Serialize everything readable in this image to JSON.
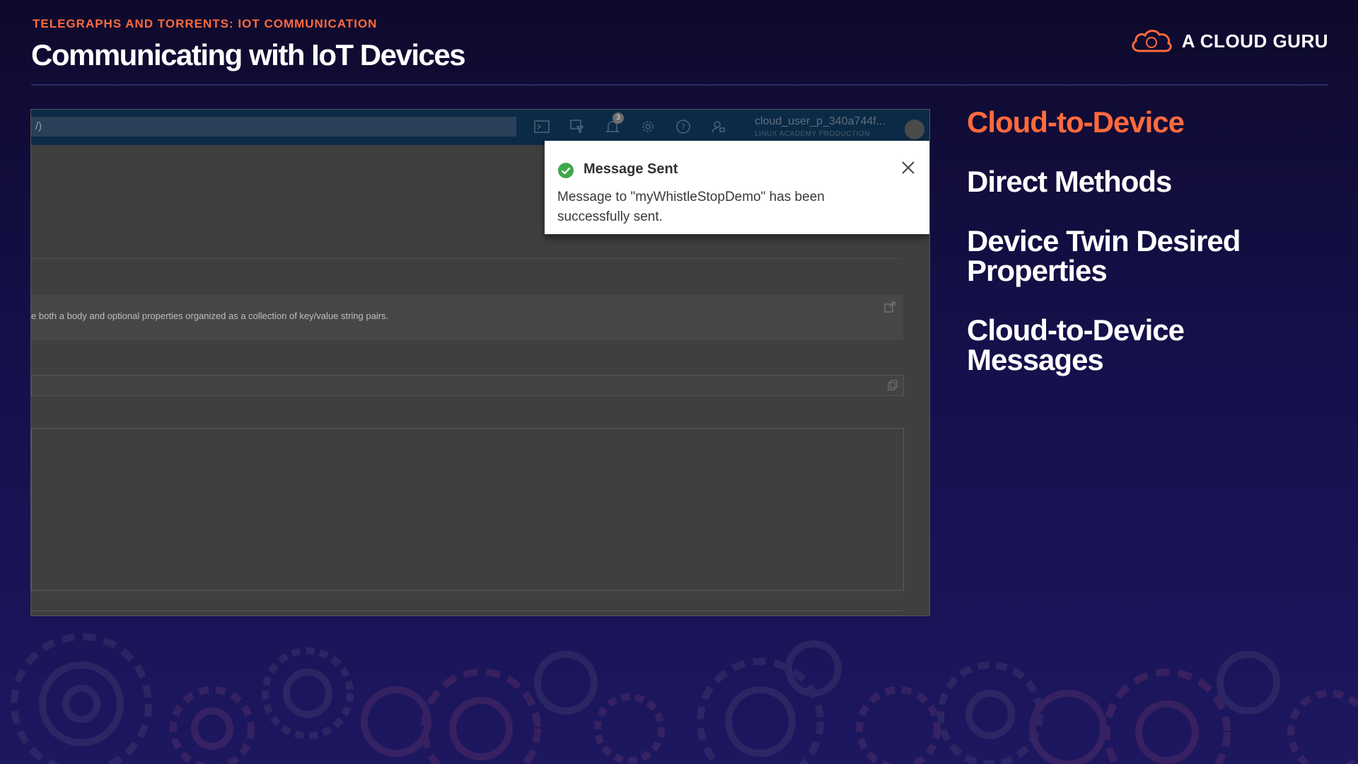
{
  "header": {
    "eyebrow": "TELEGRAPHS AND TORRENTS: IOT COMMUNICATION",
    "title": "Communicating with IoT Devices",
    "brand": "A CLOUD GURU"
  },
  "screenshot": {
    "search_text": "/)",
    "notification_count": "3",
    "user_name": "cloud_user_p_340a744f...",
    "user_org": "LINUX ACADEMY PRODUCTION",
    "info_text": "e both a body and optional properties organized as a collection of key/value string pairs.",
    "toast": {
      "title": "Message Sent",
      "message": "Message to \"myWhistleStopDemo\" has been successfully sent."
    }
  },
  "topics": [
    {
      "label": "Cloud-to-Device",
      "active": true
    },
    {
      "label": "Direct Methods",
      "active": false
    },
    {
      "label": "Device Twin Desired Properties",
      "active": false
    },
    {
      "label": "Cloud-to-Device Messages",
      "active": false
    }
  ],
  "colors": {
    "accent": "#ff6a3d",
    "background": "#15104a",
    "success": "#3ea84a"
  }
}
